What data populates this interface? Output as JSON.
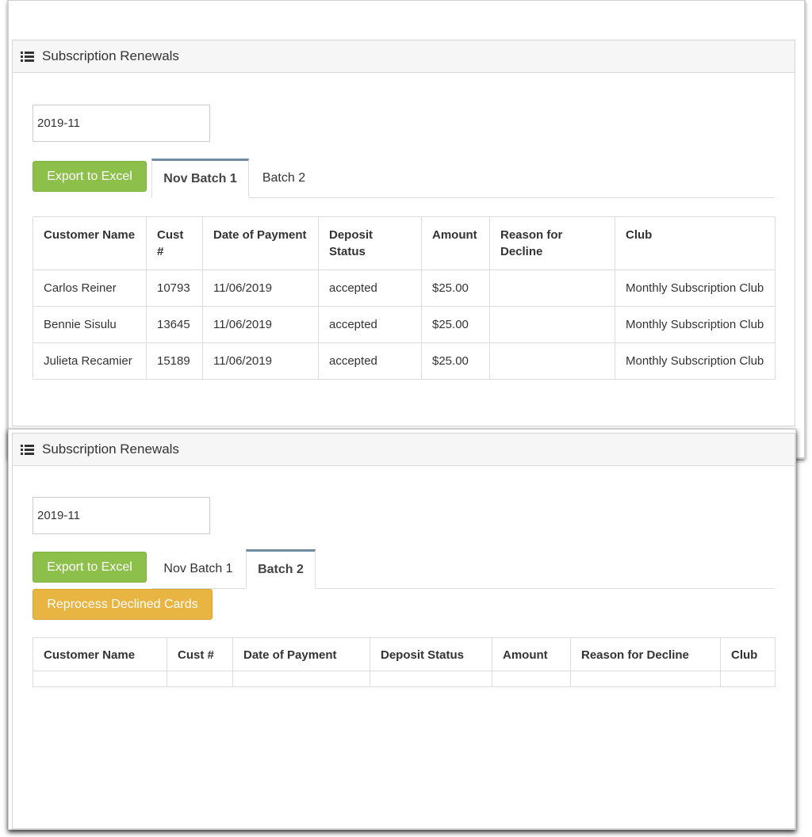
{
  "panels": [
    {
      "title": "Subscription Renewals",
      "month_value": "2019-11",
      "export_label": "Export to Excel",
      "tabs": [
        {
          "label": "Nov Batch 1",
          "active": true
        },
        {
          "label": "Batch 2",
          "active": false
        }
      ],
      "columns": [
        "Customer Name",
        "Cust #",
        "Date of Payment",
        "Deposit Status",
        "Amount",
        "Reason for Decline",
        "Club"
      ],
      "rows": [
        [
          "Carlos Reiner",
          "10793",
          "11/06/2019",
          "accepted",
          "$25.00",
          "",
          "Monthly Subscription Club"
        ],
        [
          "Bennie Sisulu",
          "13645",
          "11/06/2019",
          "accepted",
          "$25.00",
          "",
          "Monthly Subscription Club"
        ],
        [
          "Julieta Recamier",
          "15189",
          "11/06/2019",
          "accepted",
          "$25.00",
          "",
          "Monthly Subscription Club"
        ]
      ]
    },
    {
      "title": "Subscription Renewals",
      "month_value": "2019-11",
      "export_label": "Export to Excel",
      "reprocess_label": "Reprocess Declined Cards",
      "tabs": [
        {
          "label": "Nov Batch 1",
          "active": false
        },
        {
          "label": "Batch 2",
          "active": true
        }
      ],
      "columns": [
        "Customer Name",
        "Cust #",
        "Date of Payment",
        "Deposit Status",
        "Amount",
        "Reason for Decline",
        "Club"
      ],
      "rows": []
    }
  ],
  "colors": {
    "success": "#8cc04b",
    "warning": "#e8b442",
    "active_tab_border": "#6e8b9f"
  },
  "icons": {
    "heading": "list-icon"
  }
}
